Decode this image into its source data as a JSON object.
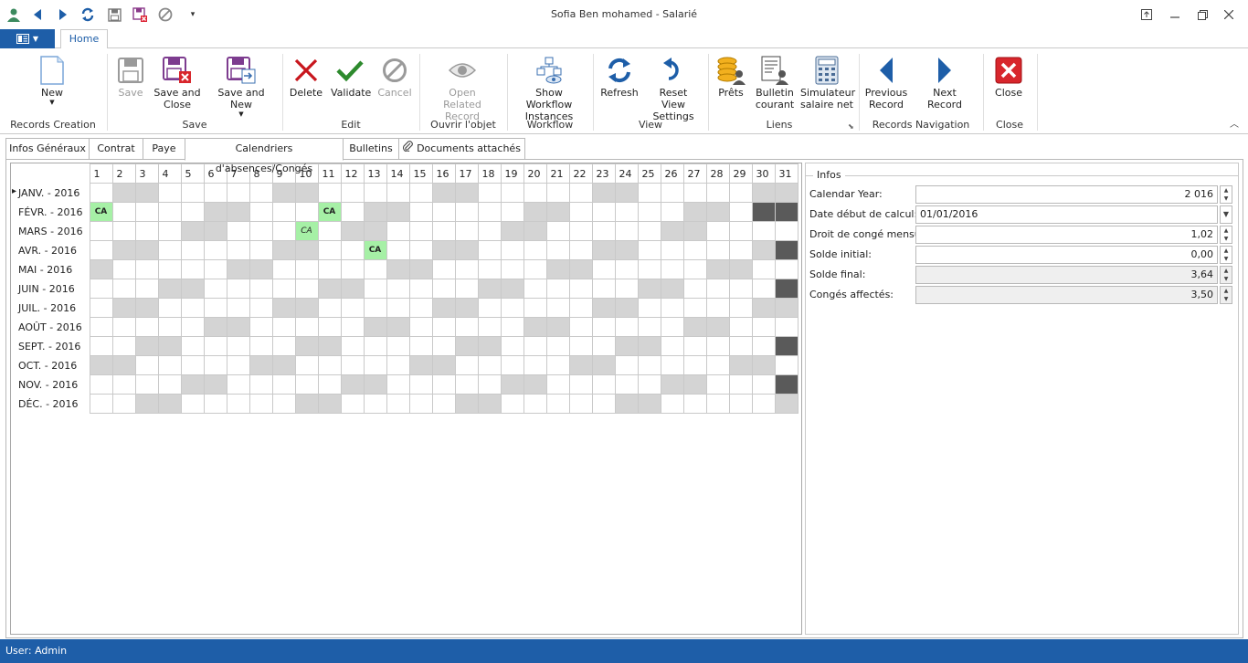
{
  "window": {
    "title": "Sofia Ben mohamed - Salarié"
  },
  "ribbon": {
    "tab": "Home",
    "groups": {
      "records_creation": "Records Creation",
      "save": "Save",
      "edit": "Edit",
      "ouvrir": "Ouvrir l'objet",
      "workflow": "Workflow",
      "view": "View",
      "liens": "Liens",
      "nav": "Records Navigation",
      "close": "Close"
    },
    "buttons": {
      "new": "New",
      "save": "Save",
      "save_close": "Save and Close",
      "save_new": "Save and New",
      "delete": "Delete",
      "validate": "Validate",
      "cancel": "Cancel",
      "open_related": "Open Related Record",
      "show_workflow": "Show Workflow Instances",
      "refresh": "Refresh",
      "reset_view": "Reset View Settings",
      "prets": "Prêts",
      "bulletin": "Bulletin courant",
      "simulateur": "Simulateur salaire net",
      "prev": "Previous Record",
      "next": "Next Record",
      "close": "Close"
    }
  },
  "form_tabs": [
    "Infos Généraux",
    "Contrat",
    "Paye",
    "Calendriers d'absences/Congés",
    "Bulletins",
    "Documents attachés"
  ],
  "calendar": {
    "days": [
      "1",
      "2",
      "3",
      "4",
      "5",
      "6",
      "7",
      "8",
      "9",
      "10",
      "11",
      "12",
      "13",
      "14",
      "15",
      "16",
      "17",
      "18",
      "19",
      "20",
      "21",
      "22",
      "23",
      "24",
      "25",
      "26",
      "27",
      "28",
      "29",
      "30",
      "31"
    ],
    "months": [
      {
        "label": "JANV. - 2016",
        "weekend": [
          2,
          3,
          9,
          10,
          16,
          17,
          23,
          24,
          30,
          31
        ],
        "na": [],
        "ca": [],
        "cai": []
      },
      {
        "label": "FÉVR. - 2016",
        "weekend": [
          6,
          7,
          13,
          14,
          20,
          21,
          27,
          28
        ],
        "na": [
          30,
          31
        ],
        "ca": [
          1,
          11
        ],
        "cai": []
      },
      {
        "label": "MARS - 2016",
        "weekend": [
          5,
          6,
          12,
          13,
          19,
          20,
          26,
          27
        ],
        "na": [],
        "ca": [],
        "cai": [
          10
        ]
      },
      {
        "label": "AVR. - 2016",
        "weekend": [
          2,
          3,
          9,
          10,
          16,
          17,
          23,
          24,
          30
        ],
        "na": [
          31
        ],
        "ca": [
          13
        ],
        "cai": []
      },
      {
        "label": "MAI - 2016",
        "weekend": [
          1,
          7,
          8,
          14,
          15,
          21,
          22,
          28,
          29
        ],
        "na": [],
        "ca": [],
        "cai": []
      },
      {
        "label": "JUIN - 2016",
        "weekend": [
          4,
          5,
          11,
          12,
          18,
          19,
          25,
          26
        ],
        "na": [
          31
        ],
        "ca": [],
        "cai": []
      },
      {
        "label": "JUIL. - 2016",
        "weekend": [
          2,
          3,
          9,
          10,
          16,
          17,
          23,
          24,
          30,
          31
        ],
        "na": [],
        "ca": [],
        "cai": []
      },
      {
        "label": "AOÛT - 2016",
        "weekend": [
          6,
          7,
          13,
          14,
          20,
          21,
          27,
          28
        ],
        "na": [],
        "ca": [],
        "cai": []
      },
      {
        "label": "SEPT. - 2016",
        "weekend": [
          3,
          4,
          10,
          11,
          17,
          18,
          24,
          25
        ],
        "na": [
          31
        ],
        "ca": [],
        "cai": []
      },
      {
        "label": "OCT. - 2016",
        "weekend": [
          1,
          2,
          8,
          9,
          15,
          16,
          22,
          23,
          29,
          30
        ],
        "na": [],
        "ca": [],
        "cai": []
      },
      {
        "label": "NOV. - 2016",
        "weekend": [
          5,
          6,
          12,
          13,
          19,
          20,
          26,
          27
        ],
        "na": [
          31
        ],
        "ca": [],
        "cai": []
      },
      {
        "label": "DÉC. - 2016",
        "weekend": [
          3,
          4,
          10,
          11,
          17,
          18,
          24,
          25,
          31
        ],
        "na": [],
        "ca": [],
        "cai": []
      }
    ],
    "ca_label": "CA"
  },
  "infos": {
    "legend": "Infos",
    "fields": [
      {
        "label": "Calendar Year:",
        "value": "2 016",
        "align": "right",
        "readonly": false,
        "control": "spin"
      },
      {
        "label": "Date début de calcul:",
        "value": "01/01/2016",
        "align": "left",
        "readonly": false,
        "control": "dropdown"
      },
      {
        "label": "Droit de congé mensul:",
        "value": "1,02",
        "align": "right",
        "readonly": false,
        "control": "spin"
      },
      {
        "label": "Solde initial:",
        "value": "0,00",
        "align": "right",
        "readonly": false,
        "control": "spin"
      },
      {
        "label": "Solde final:",
        "value": "3,64",
        "align": "right",
        "readonly": true,
        "control": "spin"
      },
      {
        "label": "Congés affectés:",
        "value": "3,50",
        "align": "right",
        "readonly": true,
        "control": "spin"
      }
    ]
  },
  "status": {
    "user": "User: Admin"
  },
  "colors": {
    "accent": "#1e5ea8",
    "weekend": "#d4d4d4",
    "unavailable": "#5a5a5a",
    "leave": "#a6f0a6"
  }
}
